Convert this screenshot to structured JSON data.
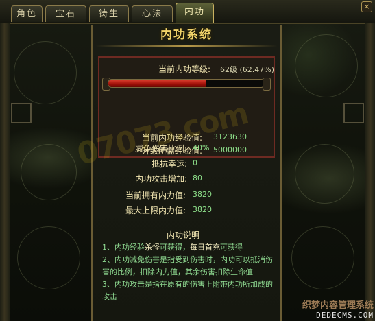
{
  "tabs": [
    {
      "label": "角色"
    },
    {
      "label": "宝石"
    },
    {
      "label": "铸生"
    },
    {
      "label": "心法"
    },
    {
      "label": "内功"
    }
  ],
  "active_tab": "内功",
  "close_label": "×",
  "panel": {
    "title": "内功系统",
    "level_label": "当前内功等级:",
    "level_value": "62级 (62.47%)",
    "progress": 0.6247,
    "exp_label": "当前内功经验值:",
    "exp_value": "3123630",
    "need_label": "升级所需经验值:",
    "need_value": "5000000",
    "stats": [
      {
        "label": "减免伤害比例:",
        "value": "40%"
      },
      {
        "label": "抵抗幸运:",
        "value": "0"
      },
      {
        "label": "内功攻击增加:",
        "value": "80"
      },
      {
        "label": "当前拥有内力值:",
        "value": "3820"
      },
      {
        "label": "最大上限内力值:",
        "value": "3820"
      }
    ],
    "desc_title": "内功说明",
    "desc_1a": "1、内功经验",
    "desc_1b": "杀怪",
    "desc_1c": "可获得，",
    "desc_1d": "每日首充",
    "desc_1e": "可获得",
    "desc_2": "2、内功减免伤害是指受到伤害时，内功可以抵消伤害的比例，扣除内力值，其余伤害扣除生命值",
    "desc_3": "3、内功攻击是指在原有的伤害上附带内功所加成的攻击"
  },
  "watermark_text": "07073.com",
  "corner": {
    "line1": "织梦内容管理系统",
    "line2": "DEDECMS.COM"
  },
  "colors": {
    "title": "#f2d46a",
    "value_green": "#8ee08a",
    "bar_red": "#c0201a",
    "border_gold": "#8a7a4a"
  }
}
